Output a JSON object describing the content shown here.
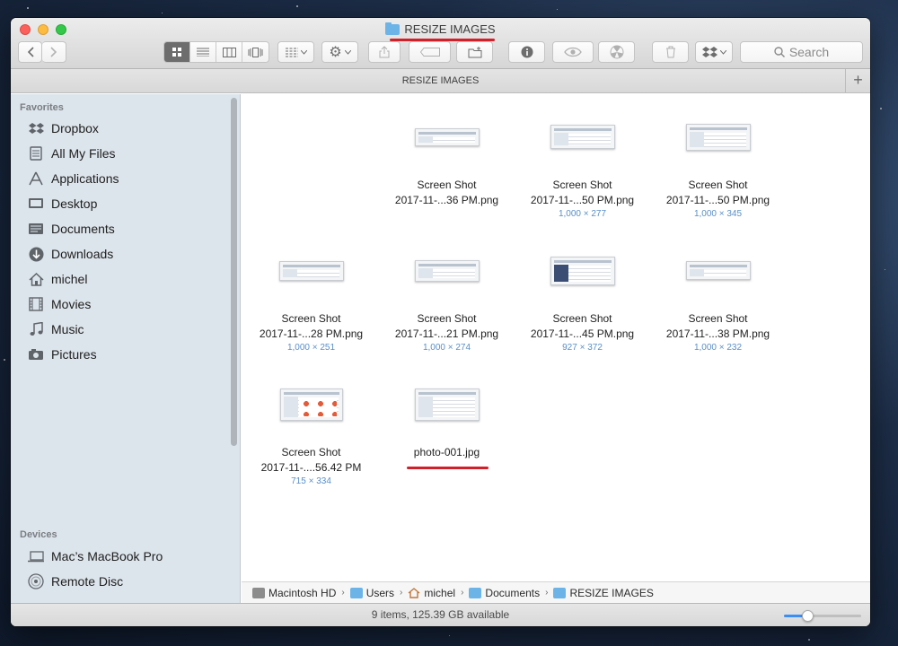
{
  "window": {
    "title": "RESIZE IMAGES",
    "path_bar_title": "RESIZE IMAGES",
    "add_tab_label": "+"
  },
  "toolbar": {
    "view_modes": [
      "icon-view",
      "list-view",
      "column-view",
      "cover-flow-view"
    ],
    "active_view": "icon-view",
    "search_placeholder": "Search"
  },
  "sidebar": {
    "favorites_heading": "Favorites",
    "favorites": [
      {
        "label": "Dropbox",
        "icon": "dropbox-icon"
      },
      {
        "label": "All My Files",
        "icon": "all-files-icon"
      },
      {
        "label": "Applications",
        "icon": "applications-icon"
      },
      {
        "label": "Desktop",
        "icon": "desktop-icon"
      },
      {
        "label": "Documents",
        "icon": "documents-icon"
      },
      {
        "label": "Downloads",
        "icon": "downloads-icon"
      },
      {
        "label": "michel",
        "icon": "home-icon"
      },
      {
        "label": "Movies",
        "icon": "movies-icon"
      },
      {
        "label": "Music",
        "icon": "music-icon"
      },
      {
        "label": "Pictures",
        "icon": "pictures-icon"
      }
    ],
    "devices_heading": "Devices",
    "devices": [
      {
        "label": "Mac’s MacBook Pro",
        "icon": "laptop-icon"
      },
      {
        "label": "Remote Disc",
        "icon": "disc-icon"
      }
    ]
  },
  "files": [
    {
      "line1": "Screen Shot",
      "line2": "2017-11-...36 PM.png",
      "dims": ""
    },
    {
      "line1": "Screen Shot",
      "line2": "2017-11-...50 PM.png",
      "dims": "1,000 × 277"
    },
    {
      "line1": "Screen Shot",
      "line2": "2017-11-...50 PM.png",
      "dims": "1,000 × 345"
    },
    {
      "line1": "Screen Shot",
      "line2": "2017-11-...28 PM.png",
      "dims": "1,000 × 251"
    },
    {
      "line1": "Screen Shot",
      "line2": "2017-11-...21 PM.png",
      "dims": "1,000 × 274"
    },
    {
      "line1": "Screen Shot",
      "line2": "2017-11-...45 PM.png",
      "dims": "927 × 372"
    },
    {
      "line1": "Screen Shot",
      "line2": "2017-11-...38 PM.png",
      "dims": "1,000 × 232"
    },
    {
      "line1": "Screen Shot",
      "line2": "2017-11-....56.42 PM",
      "dims": "715 × 334"
    },
    {
      "line1": "photo-001.jpg",
      "line2": "",
      "dims": ""
    }
  ],
  "breadcrumb": [
    {
      "label": "Macintosh HD",
      "icon": "hard-drive-icon"
    },
    {
      "label": "Users",
      "icon": "folder-icon"
    },
    {
      "label": "michel",
      "icon": "home-icon"
    },
    {
      "label": "Documents",
      "icon": "folder-icon"
    },
    {
      "label": "RESIZE IMAGES",
      "icon": "folder-icon"
    }
  ],
  "status": {
    "text": "9 items, 125.39 GB available",
    "icon_size_slider": 0.3
  },
  "colors": {
    "annotation_red": "#d0202a",
    "accent_blue": "#3b8ef5",
    "folder_blue": "#6cb4e8"
  }
}
